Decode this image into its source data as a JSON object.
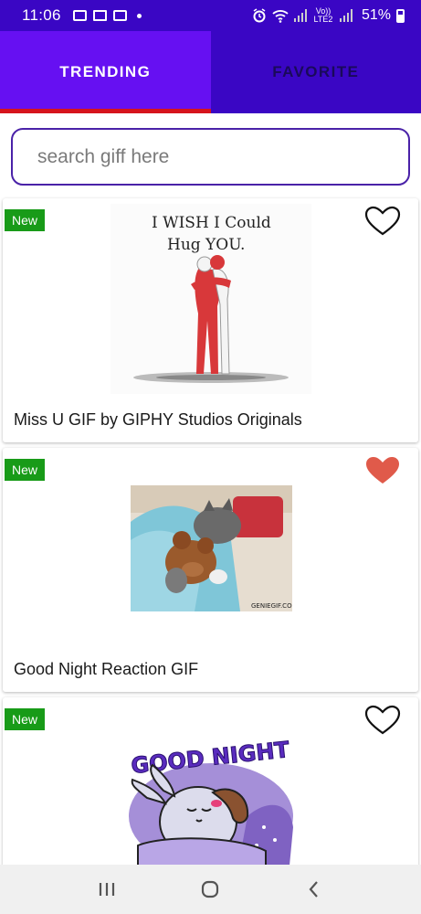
{
  "status_bar": {
    "time": "11:06",
    "network": "Vo)) LTE2",
    "battery": "51%"
  },
  "tabs": [
    {
      "label": "TRENDING",
      "active": true
    },
    {
      "label": "FAVORITE",
      "active": false
    }
  ],
  "search": {
    "placeholder": "search giff here",
    "value": ""
  },
  "cards": [
    {
      "badge": "New",
      "title": "Miss U GIF by GIPHY Studios Originals",
      "favorited": false,
      "image_text": [
        "I WISH I Could",
        "Hug YOU."
      ]
    },
    {
      "badge": "New",
      "title": "Good Night Reaction GIF",
      "favorited": true,
      "image_watermark": "GENIEGIF.COM"
    },
    {
      "badge": "New",
      "title": "",
      "favorited": false,
      "image_text": "GOOD NIGHT"
    }
  ],
  "nav": {
    "icons": [
      "recents-icon",
      "home-icon",
      "back-icon"
    ]
  },
  "colors": {
    "primary": "#3a06c4",
    "tab_active": "#6610f2",
    "indicator": "#d6141c",
    "badge": "#189b18",
    "heart_filled": "#e05a4a"
  }
}
